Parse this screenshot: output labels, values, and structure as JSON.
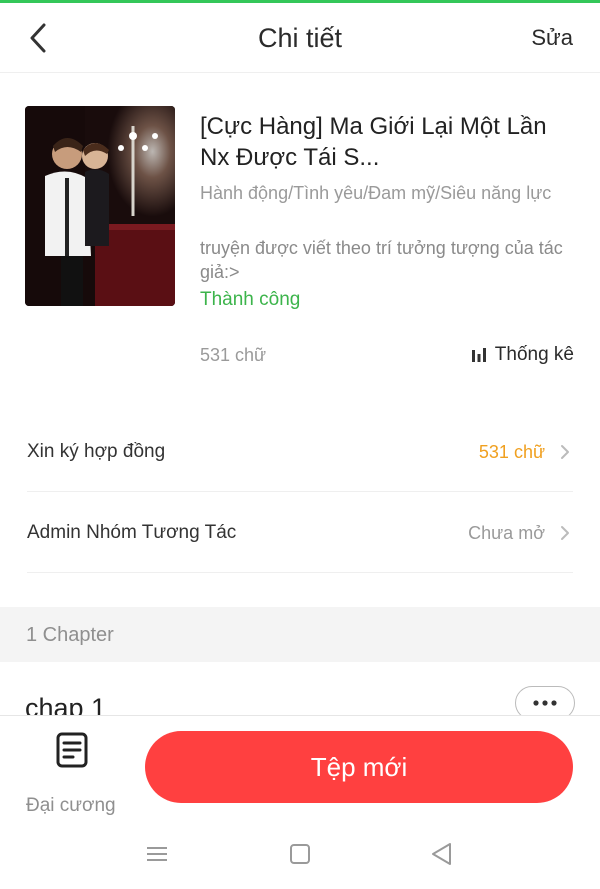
{
  "colors": {
    "accent_green": "#34c759",
    "status_green": "#3cb44b",
    "orange": "#f0a020",
    "primary_red": "#ff4040",
    "muted_gray": "#9a9a9a"
  },
  "header": {
    "title": "Chi tiết",
    "edit_label": "Sửa",
    "back_icon": "chevron-left-icon"
  },
  "book": {
    "title": "[Cực Hàng] Ma Giới Lại Một Lần Nx Được Tái S...",
    "genres": "Hành động/Tình yêu/Đam mỹ/Siêu năng lực",
    "description": "truyện được viết theo trí tưởng tượng của tác giả:>",
    "status": "Thành công",
    "word_count": "531 chữ",
    "stats_label": "Thống kê",
    "stats_icon": "bar-chart-icon"
  },
  "rows": {
    "contract_label": "Xin ký hợp đồng",
    "contract_value": "531 chữ",
    "admin_label": "Admin Nhóm Tương Tác",
    "admin_value": "Chưa mở"
  },
  "chapters": {
    "section_label": "1 Chapter",
    "items": [
      {
        "title": "chap 1",
        "more_icon": "more-horizontal-icon"
      }
    ]
  },
  "bottom": {
    "outline_label": "Đại cương",
    "outline_icon": "document-list-icon",
    "new_file_label": "Tệp mới"
  },
  "navbar": {
    "icons": [
      "menu-icon",
      "home-square-icon",
      "back-triangle-icon"
    ]
  }
}
